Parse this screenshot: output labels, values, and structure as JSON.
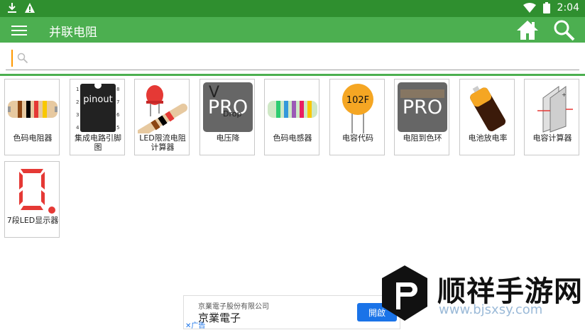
{
  "status_bar": {
    "time": "2:04",
    "icons_left": [
      "download-icon",
      "warning-icon"
    ],
    "icons_right": [
      "wifi-icon",
      "battery-icon"
    ]
  },
  "app_bar": {
    "title": "并联电阻"
  },
  "search": {
    "placeholder": ""
  },
  "tiles": [
    {
      "label": "色码电阻器",
      "icon": "resistor-color-icon"
    },
    {
      "label": "集成电路引脚图",
      "icon": "ic-pinout-icon",
      "image_text": "pinout",
      "pins_left": [
        "1",
        "2",
        "3",
        "4"
      ],
      "pins_right": [
        "8",
        "7",
        "6",
        "5"
      ]
    },
    {
      "label": "LED限流电阻计算器",
      "icon": "led-resistor-icon"
    },
    {
      "label": "电压降",
      "icon": "voltage-drop-pro-icon",
      "image_text": "PRO",
      "image_small": "V",
      "image_small2": "Drop"
    },
    {
      "label": "色码电感器",
      "icon": "inductor-color-icon"
    },
    {
      "label": "电容代码",
      "icon": "capacitor-code-icon",
      "image_text": "102F"
    },
    {
      "label": "电阻到色环",
      "icon": "resistor-to-color-pro-icon",
      "image_text": "PRO"
    },
    {
      "label": "电池放电率",
      "icon": "battery-discharge-icon"
    },
    {
      "label": "电容计算器",
      "icon": "capacitor-calculator-icon"
    },
    {
      "label": "7段LED显示器",
      "icon": "seven-segment-icon"
    }
  ],
  "ad": {
    "company": "京業電子股份有限公司",
    "name": "京業電子",
    "open_label": "開啟",
    "ad_tag": "广告"
  },
  "watermark": {
    "text": "顺祥手游网",
    "url": "www.bjsxsy.com"
  },
  "colors": {
    "status_bar": "#2f8f2f",
    "app_bar": "#4caf50",
    "accent": "#ff9800"
  }
}
